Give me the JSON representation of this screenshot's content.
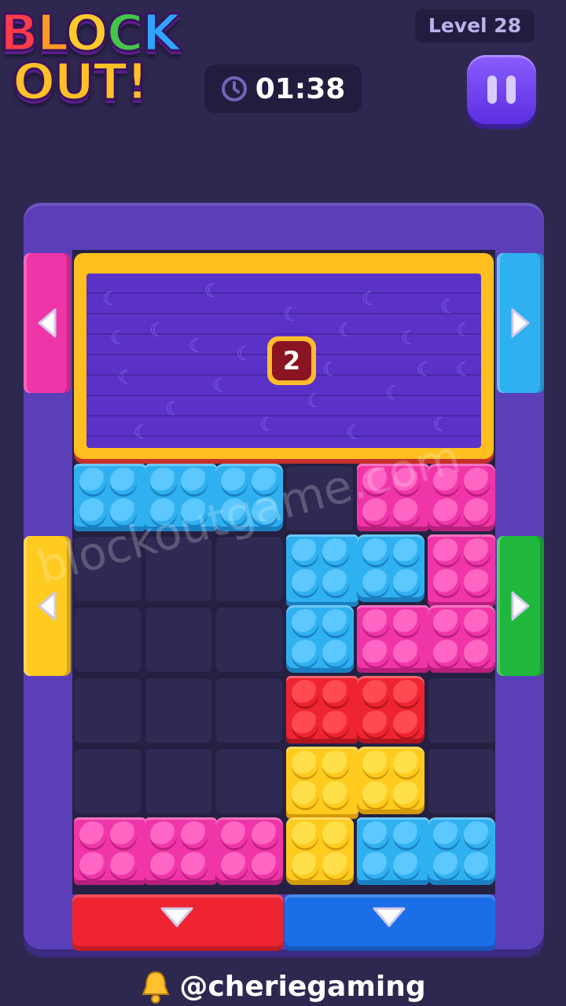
{
  "header": {
    "logo_line1": [
      "B",
      "L",
      "O",
      "C",
      "K"
    ],
    "logo_line2": "OUT!",
    "level_label": "Level 28",
    "timer": "01:38"
  },
  "lock_block": {
    "count": "2"
  },
  "watermark": "blockoutgame.com",
  "footer": {
    "handle": "@cheriegaming"
  },
  "colors": {
    "blue": "#2fb0f0",
    "pink": "#f035a8",
    "red": "#ee2430",
    "yellow": "#ffcb1f",
    "green": "#1fb83c",
    "board": "#5a3fb8"
  },
  "icons": {
    "clock": "clock-icon",
    "pause": "pause-icon",
    "bell": "bell-icon"
  }
}
